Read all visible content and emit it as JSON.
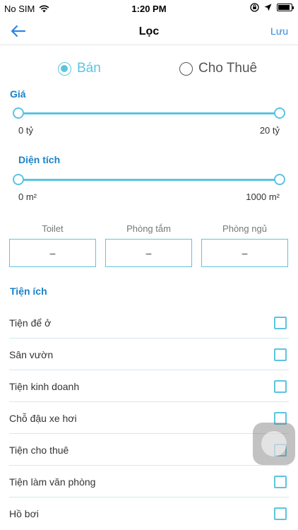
{
  "status_bar": {
    "carrier": "No SIM",
    "time": "1:20 PM",
    "battery_level": 0.9
  },
  "nav": {
    "title": "Lọc",
    "save_label": "Lưu"
  },
  "listing_type": {
    "options": [
      {
        "label": "Bán",
        "selected": true
      },
      {
        "label": "Cho Thuê",
        "selected": false
      }
    ]
  },
  "price": {
    "label": "Giá",
    "min_label": "0 tỷ",
    "max_label": "20 tỷ",
    "low": 0,
    "high": 20,
    "range": [
      0,
      20
    ]
  },
  "area": {
    "label": "Diện tích",
    "min_label": "0 m²",
    "max_label": "1000 m²",
    "low": 0,
    "high": 1000,
    "range": [
      0,
      1000
    ]
  },
  "counters": [
    {
      "label": "Toilet",
      "value": "–"
    },
    {
      "label": "Phòng tắm",
      "value": "–"
    },
    {
      "label": "Phòng ngủ",
      "value": "–"
    }
  ],
  "amenities": {
    "title": "Tiện ích",
    "items": [
      {
        "label": "Tiện để ở",
        "checked": false
      },
      {
        "label": "Sân vườn",
        "checked": false
      },
      {
        "label": "Tiện kinh doanh",
        "checked": false
      },
      {
        "label": "Chỗ đậu xe hơi",
        "checked": false
      },
      {
        "label": "Tiện cho thuê",
        "checked": false
      },
      {
        "label": "Tiện làm văn phòng",
        "checked": false
      },
      {
        "label": "Hồ bơi",
        "checked": false
      }
    ]
  },
  "colors": {
    "accent": "#5cc4e0",
    "link": "#1a82c9",
    "nav_link": "#2e86de"
  }
}
